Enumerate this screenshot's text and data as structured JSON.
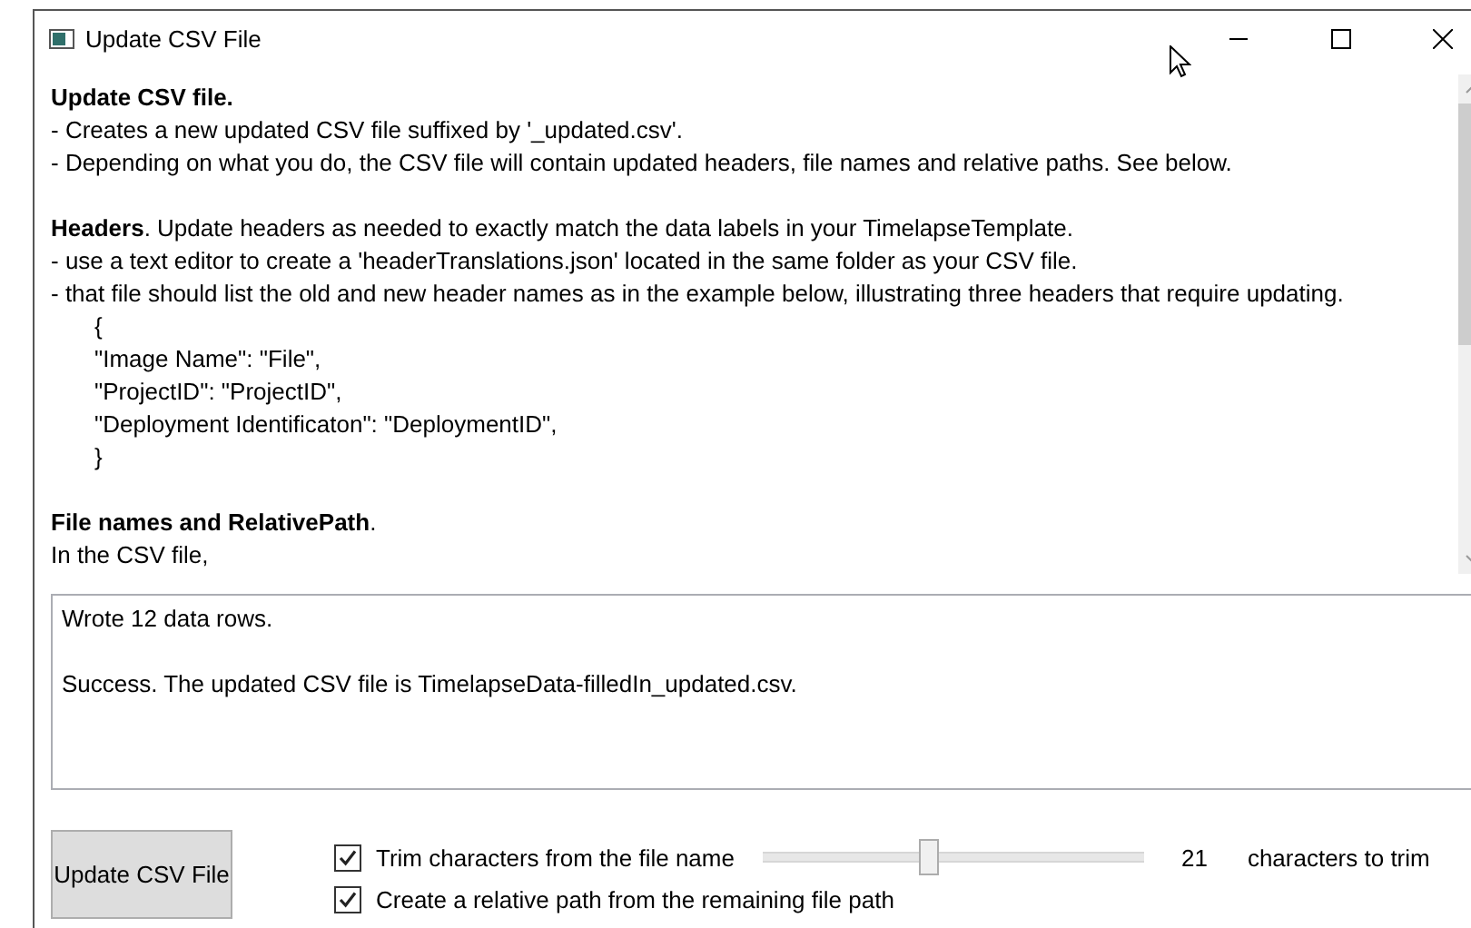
{
  "window": {
    "title": "Update CSV File"
  },
  "help": [
    {
      "lines": [
        {
          "kind": "heading",
          "text": "Update CSV file."
        },
        {
          "kind": "text",
          "text": "- Creates a new updated CSV file suffixed by '_updated.csv'."
        },
        {
          "kind": "text",
          "text": "- Depending on what you do, the CSV file will contain updated headers, file names and relative paths. See below."
        }
      ]
    },
    {
      "lines": [
        {
          "kind": "text",
          "text": "**Headers**. Update headers as needed to exactly match the data labels in your TimelapseTemplate."
        },
        {
          "kind": "text",
          "text": "- use a text editor to create a 'headerTranslations.json' located in the same folder as your CSV file."
        },
        {
          "kind": "text",
          "text": "- that file should list the old and new header names as in the example below, illustrating three headers that require updating."
        },
        {
          "kind": "code",
          "text": "{"
        },
        {
          "kind": "code",
          "text": "\"Image Name\": \"File\","
        },
        {
          "kind": "code",
          "text": "\"ProjectID\": \"ProjectID\","
        },
        {
          "kind": "code",
          "text": "\"Deployment Identificaton\": \"DeploymentID\","
        },
        {
          "kind": "code",
          "text": "}"
        }
      ]
    },
    {
      "lines": [
        {
          "kind": "text",
          "text": "**File names and RelativePath**."
        },
        {
          "kind": "text",
          "text": "In the CSV file,"
        }
      ]
    }
  ],
  "output": "Wrote 12 data rows.\n\nSuccess. The updated CSV file is TimelapseData-filledIn_updated.csv.",
  "update_button": "Update CSV File",
  "options": [
    {
      "label": "Trim characters from the file name",
      "checked": true
    },
    {
      "label": "Create a relative path from the remaining file path",
      "checked": true
    }
  ],
  "trim_slider": {
    "level": 0.43,
    "value": "21",
    "unit": "characters to trim"
  }
}
